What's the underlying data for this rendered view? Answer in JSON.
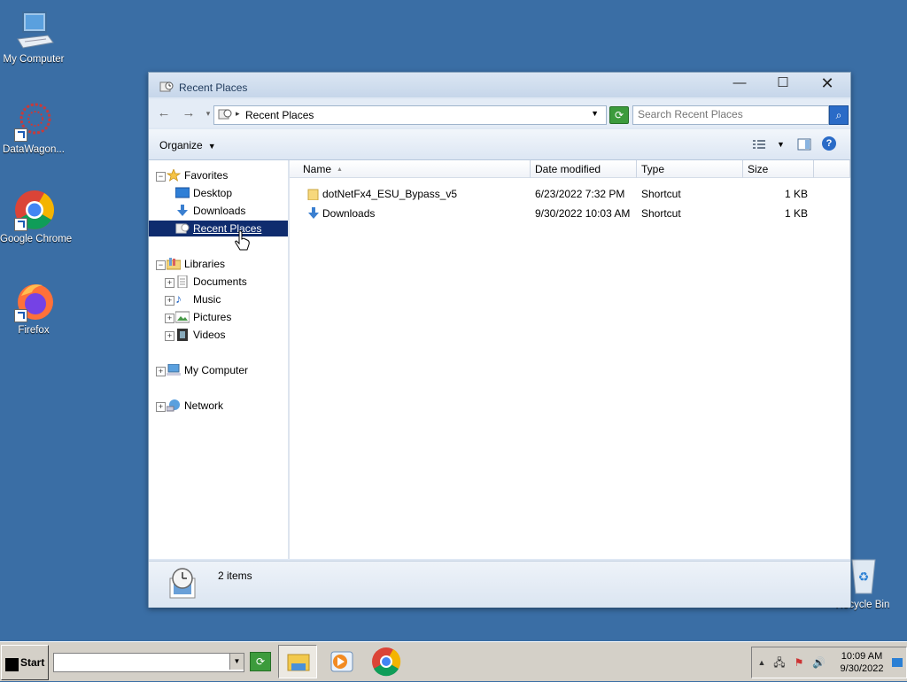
{
  "desktop": {
    "icons": [
      {
        "label": "My Computer"
      },
      {
        "label": "DataWagon..."
      },
      {
        "label": "Google Chrome"
      },
      {
        "label": "Firefox"
      },
      {
        "label": "Recycle Bin"
      }
    ]
  },
  "window": {
    "title": "Recent Places",
    "address": "Recent Places",
    "search_placeholder": "Search Recent Places",
    "organize_label": "Organize"
  },
  "navpane": {
    "favorites": "Favorites",
    "desktop": "Desktop",
    "downloads": "Downloads",
    "recent_places": "Recent Places",
    "libraries": "Libraries",
    "documents": "Documents",
    "music": "Music",
    "pictures": "Pictures",
    "videos": "Videos",
    "my_computer": "My Computer",
    "network": "Network"
  },
  "columns": {
    "name": "Name",
    "date": "Date modified",
    "type": "Type",
    "size": "Size"
  },
  "files": [
    {
      "name": "dotNetFx4_ESU_Bypass_v5",
      "date": "6/23/2022 7:32 PM",
      "type": "Shortcut",
      "size": "1 KB",
      "icon": "folder-icon"
    },
    {
      "name": "Downloads",
      "date": "9/30/2022 10:03 AM",
      "type": "Shortcut",
      "size": "1 KB",
      "icon": "downloads-icon"
    }
  ],
  "status": {
    "count": "2 items"
  },
  "taskbar": {
    "start_label": "Start",
    "time": "10:09 AM",
    "date": "9/30/2022"
  },
  "colors": {
    "desktop_bg": "#3a6ea5",
    "selection": "#0f2c6e"
  }
}
